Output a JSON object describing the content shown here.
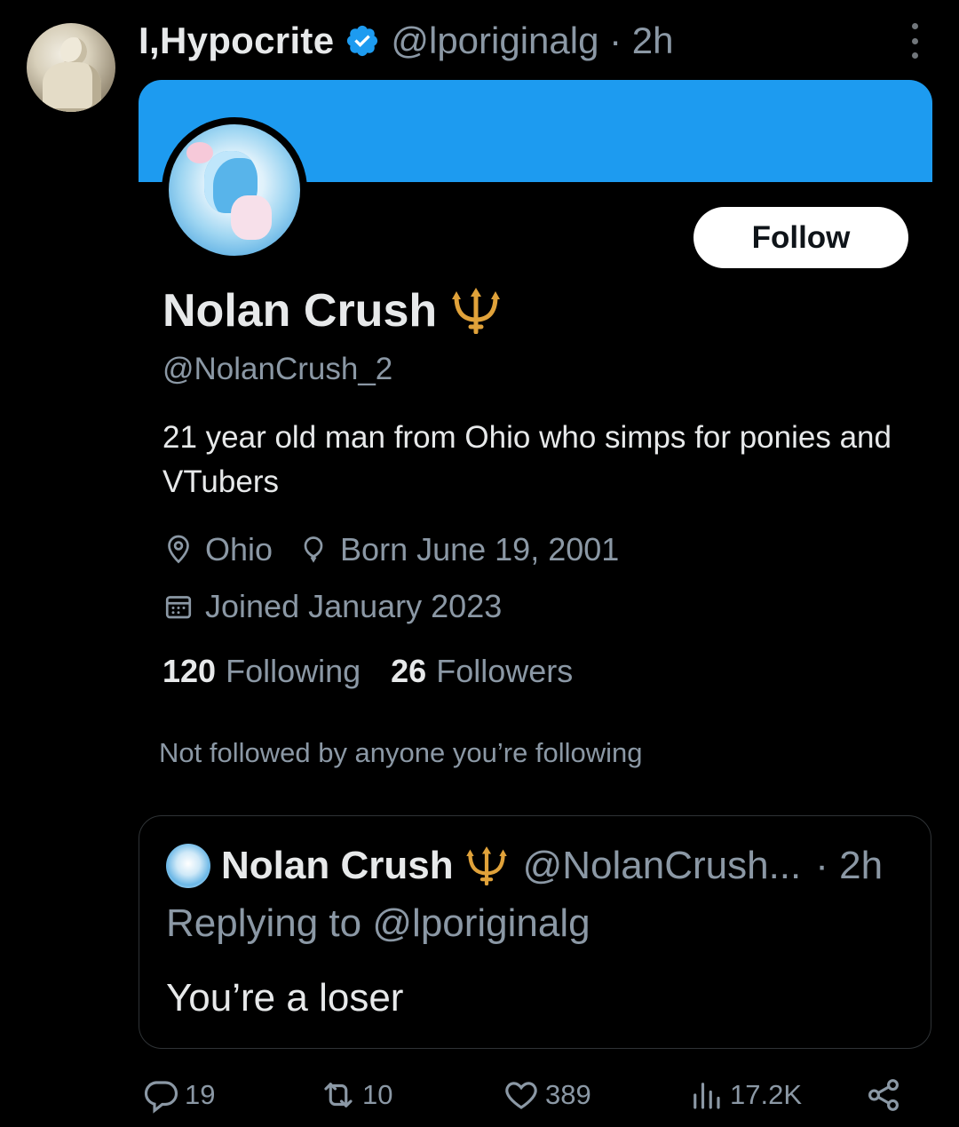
{
  "tweet": {
    "author_name": "I,Hypocrite",
    "handle_time": "@lporiginalg · 2h",
    "icons": {
      "verified": "verified-badge-icon",
      "more": "more-options-icon"
    },
    "colors": {
      "verified": "#1d9bf0",
      "banner": "#1d9bf0"
    }
  },
  "profile": {
    "name": "Nolan Crush",
    "handle": "@NolanCrush_2",
    "bio": "21 year old man from Ohio who simps for ponies and VTubers",
    "location": "Ohio",
    "birthday": "Born June 19, 2001",
    "joined": "Joined January 2023",
    "following_count": "120",
    "following_label": "Following",
    "followers_count": "26",
    "followers_label": "Followers",
    "not_followed_text": "Not followed by anyone you’re following",
    "follow_label": "Follow",
    "emoji": "trident-emoji"
  },
  "quote": {
    "name": "Nolan Crush",
    "handle": "@NolanCrush...",
    "time": "· 2h",
    "replying_prefix": "Replying to",
    "replying_mention": "@lporiginalg",
    "text": "You’re a loser"
  },
  "actions": {
    "replies": "19",
    "reposts": "10",
    "likes": "389",
    "views": "17.2K"
  }
}
